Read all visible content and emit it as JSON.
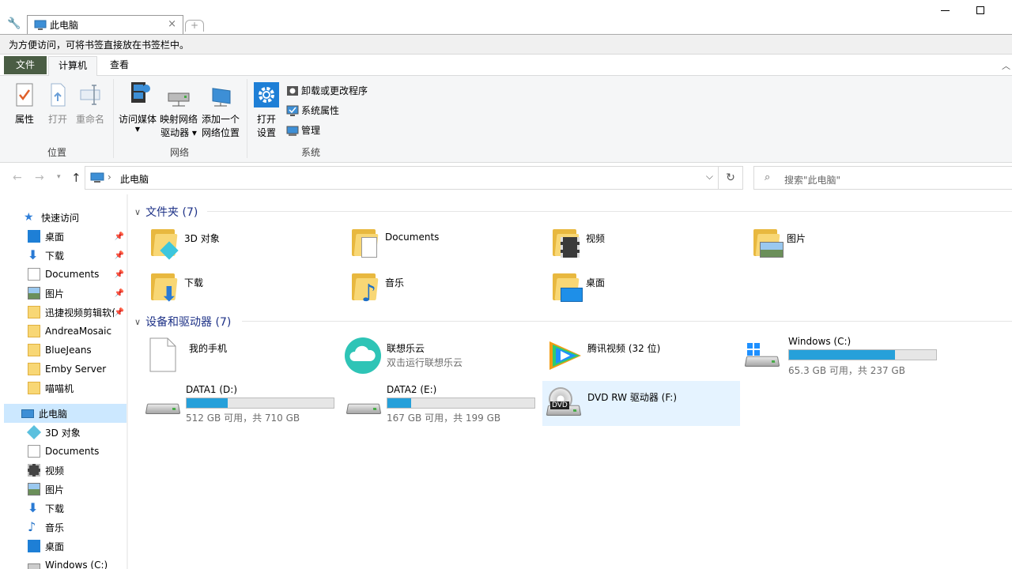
{
  "window": {
    "tab_title": "此电脑",
    "tab_close": "×",
    "new_tab": "+"
  },
  "bookmark_bar": {
    "text": "为方便访问，可将书签直接放在书签栏中。"
  },
  "ribbon_tabs": {
    "file": "文件",
    "computer": "计算机",
    "view": "查看"
  },
  "ribbon": {
    "properties": "属性",
    "open": "打开",
    "rename": "重命名",
    "access_media_1": "访问媒体",
    "map_drive_1": "映射网络",
    "map_drive_2": "驱动器 ▾",
    "add_location_1": "添加一个",
    "add_location_2": "网络位置",
    "open_settings_1": "打开",
    "open_settings_2": "设置",
    "uninstall": "卸载或更改程序",
    "sys_props": "系统属性",
    "manage": "管理",
    "group_location": "位置",
    "group_network": "网络",
    "group_system": "系统"
  },
  "address": {
    "path": "此电脑",
    "search_placeholder": "搜索\"此电脑\""
  },
  "nav": {
    "quick_access": "快速访问",
    "items_quick": [
      "桌面",
      "下载",
      "Documents",
      "图片",
      "迅捷视频剪辑软件",
      "AndreaMosaic",
      "BlueJeans",
      "Emby Server",
      "喵喵机"
    ],
    "this_pc": "此电脑",
    "items_pc": [
      "3D 对象",
      "Documents",
      "视频",
      "图片",
      "下载",
      "音乐",
      "桌面",
      "Windows (C:)"
    ]
  },
  "folders": {
    "header": "文件夹 (7)",
    "items": [
      "3D 对象",
      "Documents",
      "视频",
      "图片",
      "下载",
      "音乐",
      "桌面"
    ]
  },
  "devices": {
    "header": "设备和驱动器 (7)",
    "phone": "我的手机",
    "lenovo_name": "联想乐云",
    "lenovo_sub": "双击运行联想乐云",
    "tencent": "腾讯视频 (32 位)",
    "dvd": "DVD RW 驱动器 (F:)",
    "dvd_badge": "DVD",
    "drives": [
      {
        "name": "Windows (C:)",
        "info": "65.3 GB 可用，共 237 GB",
        "used_fraction": 0.72
      },
      {
        "name": "DATA1 (D:)",
        "info": "512 GB 可用，共 710 GB",
        "used_fraction": 0.28
      },
      {
        "name": "DATA2 (E:)",
        "info": "167 GB 可用，共 199 GB",
        "used_fraction": 0.16
      }
    ]
  },
  "colors": {
    "accent": "#26a0da",
    "selection": "#cce8ff",
    "header_blue": "#1e3287",
    "file_tab": "#4a5d44"
  }
}
